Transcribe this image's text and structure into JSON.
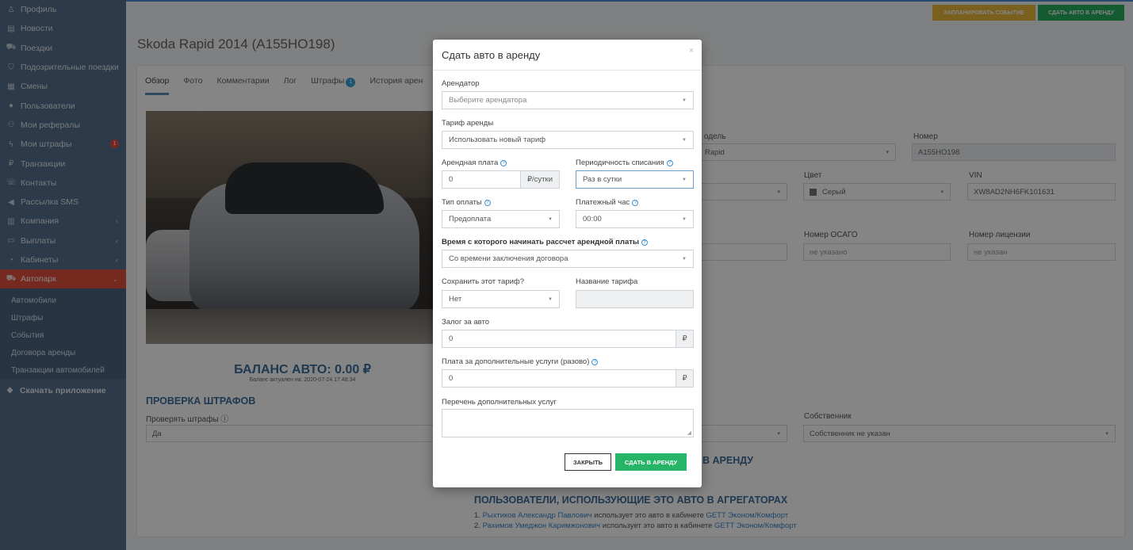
{
  "sidebar": {
    "items": [
      {
        "label": "Профиль",
        "icon": "user-icon"
      },
      {
        "label": "Новости",
        "icon": "newspaper-icon"
      },
      {
        "label": "Поездки",
        "icon": "car-icon"
      },
      {
        "label": "Подозрительные поездки",
        "icon": "shield-icon"
      },
      {
        "label": "Смены",
        "icon": "calendar-icon"
      },
      {
        "label": "Пользователи",
        "icon": "person-icon"
      },
      {
        "label": "Мои рефералы",
        "icon": "users-icon"
      },
      {
        "label": "Мои штрафы",
        "icon": "flash-icon",
        "badge": "1"
      },
      {
        "label": "Транзакции",
        "icon": "ruble-icon"
      },
      {
        "label": "Контакты",
        "icon": "phone-icon"
      },
      {
        "label": "Рассылка SMS",
        "icon": "megaphone-icon"
      },
      {
        "label": "Компания",
        "icon": "building-icon",
        "chevron": "‹"
      },
      {
        "label": "Выплаты",
        "icon": "money-icon",
        "chevron": "‹"
      },
      {
        "label": "Кабинеты",
        "icon": "circle-icon",
        "chevron": "‹"
      },
      {
        "label": "Автопарк",
        "icon": "car-icon",
        "chevron": "⌄",
        "active": true
      }
    ],
    "sub_items": [
      "Автомобили",
      "Штрафы",
      "События",
      "Договора аренды",
      "Транзакции автомобилей"
    ],
    "download": "Скачать приложение"
  },
  "topbar": {
    "plan_event": "Запланировать событие",
    "rent_car": "Сдать авто в аренду"
  },
  "page": {
    "title": "Skoda Rapid 2014 (А155НО198)",
    "tabs": [
      {
        "label": "Обзор",
        "active": true
      },
      {
        "label": "Фото"
      },
      {
        "label": "Комментарии"
      },
      {
        "label": "Лог"
      },
      {
        "label": "Штрафы",
        "badge": "1"
      },
      {
        "label": "История арен"
      }
    ],
    "balance": "БАЛАНС АВТО: 0.00 ₽",
    "balance_sub": "Баланс актуален на: 2020-07-24 17:48:34",
    "fines_section": "ПРОВЕРКА ШТРАФОВ",
    "check_fines_label": "Проверять штрафы ⓘ",
    "check_fines_value": "Да",
    "model_label": "одель",
    "model_value": "Rapid",
    "number_label": "Номер",
    "number_value": "А155НО198",
    "color_label": "Цвет",
    "color_value": "Серый",
    "vin_label": "VIN",
    "vin_value": "XW8AD2NH6FK101631",
    "osago_label": "Номер ОСАГО",
    "osago_value": "не указано",
    "license_label": "Номер лицензии",
    "license_value": "не указан",
    "owner_label": "Собственник",
    "owner_value": "Собственник не указан",
    "rent_section_partial": "В АРЕНДУ",
    "aggregators_section": "ПОЛЬЗОВАТЕЛИ, ИСПОЛЬЗУЮЩИЕ ЭТО АВТО В АГРЕГАТОРАХ",
    "aggregator_users": [
      {
        "num": "1.",
        "name": "Рыхтиков Александр Павлович",
        "mid": " использует это авто в кабинете ",
        "cabinet": "GETT Эконом/Комфорт"
      },
      {
        "num": "2.",
        "name": "Рахимов Умеджон Каримжонович",
        "mid": " использует это авто в кабинете ",
        "cabinet": "GETT Эконом/Комфорт"
      }
    ]
  },
  "modal": {
    "title": "Сдать авто в аренду",
    "close": "×",
    "tenant_label": "Арендатор",
    "tenant_placeholder": "Выберите арендатора",
    "tariff_label": "Тариф аренды",
    "tariff_value": "Использовать новый тариф",
    "fee_label": "Арендная плата",
    "fee_value": "0",
    "fee_unit": "₽/сутки",
    "period_label": "Периодичность списания",
    "period_value": "Раз в сутки",
    "payment_type_label": "Тип оплаты",
    "payment_type_value": "Предоплата",
    "payment_hour_label": "Платежный час",
    "payment_hour_value": "00:00",
    "start_time_label": "Время с которого начинать рассчет арендной платы",
    "start_time_value": "Со времени заключения договора",
    "save_tariff_label": "Сохранить этот тариф?",
    "save_tariff_value": "Нет",
    "tariff_name_label": "Название тарифа",
    "deposit_label": "Залог за авто",
    "deposit_value": "0",
    "currency": "₽",
    "extra_fee_label": "Плата за дополнительные услуги (разово)",
    "extra_fee_value": "0",
    "extra_list_label": "Перечень дополнительных услуг",
    "close_button": "Закрыть",
    "rent_button": "Сдать в аренду"
  }
}
